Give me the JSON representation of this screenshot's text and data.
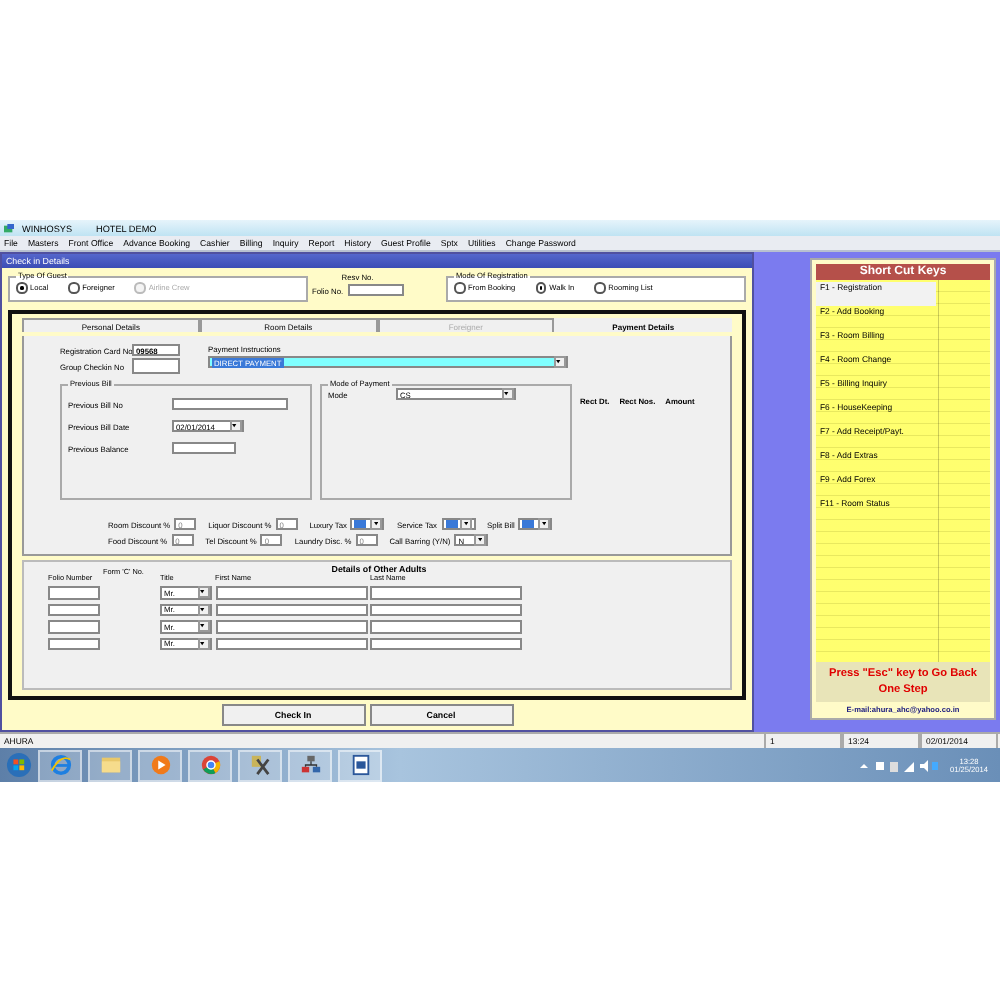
{
  "app_title_bar": {
    "app": "WINHOSYS",
    "document": "HOTEL DEMO"
  },
  "menu": [
    "File",
    "Masters",
    "Front Office",
    "Advance Booking",
    "Cashier",
    "Billing",
    "Inquiry",
    "Report",
    "History",
    "Guest Profile",
    "Sptx",
    "Utilities",
    "Change Password"
  ],
  "checkin": {
    "title": "Check in Details",
    "guest_type": {
      "legend": "Type Of Guest",
      "options": [
        {
          "label": "Local",
          "selected": true,
          "disabled": false
        },
        {
          "label": "Foreigner",
          "selected": false,
          "disabled": false
        },
        {
          "label": "Airline Crew",
          "selected": false,
          "disabled": true
        }
      ]
    },
    "resv_label": "Resv No.",
    "folio_label": "Folio No.",
    "registration_mode": {
      "legend": "Mode Of Registration",
      "options": [
        {
          "label": "From Booking",
          "selected": false,
          "disabled": false
        },
        {
          "label": "Walk In",
          "selected": true,
          "disabled": false
        },
        {
          "label": "Rooming List",
          "selected": false,
          "disabled": false
        }
      ]
    },
    "tabs": [
      {
        "label": "Personal Details",
        "selected": false,
        "disabled": false
      },
      {
        "label": "Room Details",
        "selected": false,
        "disabled": false
      },
      {
        "label": "Foreigner",
        "selected": false,
        "disabled": true
      },
      {
        "label": "Payment Details",
        "selected": true,
        "disabled": false
      }
    ],
    "payment": {
      "reg_card_label": "Registration Card No",
      "reg_card_value": "09568",
      "group_checkin_label": "Group Checkin No",
      "instructions_label": "Payment Instructions",
      "instructions_value": "DIRECT PAYMENT",
      "previous_bill": {
        "legend": "Previous Bill",
        "bill_no_label": "Previous Bill No",
        "bill_date_label": "Previous Bill Date",
        "bill_date_value": "02/01/2014",
        "balance_label": "Previous Balance"
      },
      "mode_of_payment": {
        "legend": "Mode of Payment",
        "mode_label": "Mode",
        "mode_value": "CS"
      },
      "receipt_columns": [
        "Rect Dt.",
        "Rect Nos.",
        "Amount"
      ],
      "discount_rows": [
        [
          {
            "label": "Room Discount %",
            "kind": "text",
            "placeholder": "0"
          },
          {
            "label": "Liquor Discount %",
            "kind": "text",
            "placeholder": "0"
          },
          {
            "label": "Luxury Tax",
            "kind": "select",
            "highlighted": true
          },
          {
            "label": "Service Tax",
            "kind": "select",
            "highlighted": true
          },
          {
            "label": "Split Bill",
            "kind": "select",
            "highlighted": true
          }
        ],
        [
          {
            "label": "Food Discount %",
            "kind": "text",
            "placeholder": "0"
          },
          {
            "label": "Tel Discount %",
            "kind": "text",
            "placeholder": "0"
          },
          {
            "label": "Laundry Disc. %",
            "kind": "text",
            "placeholder": "0"
          },
          {
            "label": "Call Barring (Y/N)",
            "kind": "select",
            "value": "N",
            "highlighted": false
          }
        ]
      ]
    },
    "other_adults": {
      "title": "Details of Other Adults",
      "columns": [
        "Folio Number",
        "Form 'C' No.",
        "Title",
        "First Name",
        "Last Name"
      ],
      "rows": [
        {
          "title": "Mr."
        },
        {
          "title": "Mr."
        },
        {
          "title": "Mr."
        },
        {
          "title": "Mr."
        }
      ]
    },
    "buttons": [
      "Check In",
      "Cancel"
    ]
  },
  "shortcuts": {
    "title": "Short Cut Keys",
    "items": [
      {
        "label": "F1 - Registration",
        "selected": true
      },
      {
        "label": "F2 - Add Booking",
        "selected": false
      },
      {
        "label": "F3 - Room Billing",
        "selected": false
      },
      {
        "label": "F4 - Room Change",
        "selected": false
      },
      {
        "label": "F5 - Billing Inquiry",
        "selected": false
      },
      {
        "label": "F6 - HouseKeeping",
        "selected": false
      },
      {
        "label": "F7 - Add Receipt/Payt.",
        "selected": false
      },
      {
        "label": "F8 - Add Extras",
        "selected": false
      },
      {
        "label": "F9 - Add Forex",
        "selected": false
      },
      {
        "label": "F11 - Room Status",
        "selected": false
      }
    ],
    "hint": "Press \"Esc\" key to Go Back One Step",
    "email": "E-mail:ahura_ahc@yahoo.co.in"
  },
  "status_bar": [
    "AHURA",
    "1",
    "13:24",
    "02/01/2014"
  ],
  "taskbar": {
    "clock_time": "13:28",
    "clock_date": "01/25/2014"
  }
}
